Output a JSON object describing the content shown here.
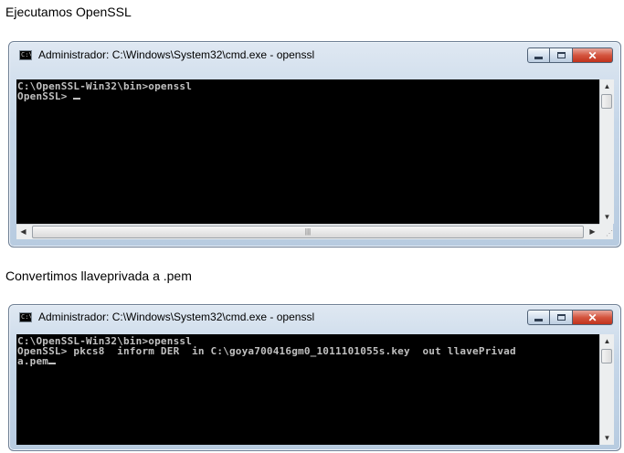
{
  "captions": {
    "first": "Ejecutamos OpenSSL",
    "second": "Convertimos llaveprivada  a .pem"
  },
  "windows": [
    {
      "title": "Administrador: C:\\Windows\\System32\\cmd.exe - openssl",
      "icon": "cmd-icon",
      "console_lines": [
        "C:\\OpenSSL-Win32\\bin>openssl",
        "OpenSSL> "
      ],
      "has_horizontal_scrollbar": true
    },
    {
      "title": "Administrador: C:\\Windows\\System32\\cmd.exe - openssl",
      "icon": "cmd-icon",
      "console_lines": [
        "C:\\OpenSSL-Win32\\bin>openssl",
        "OpenSSL> pkcs8  inform DER  in C:\\goya700416gm0_1011101055s.key  out llavePrivad",
        "a.pem"
      ],
      "has_horizontal_scrollbar": false
    }
  ],
  "window_controls": {
    "minimize": "minimize-icon",
    "maximize": "maximize-icon",
    "close": "close-icon",
    "close_glyph": "✕"
  },
  "colors": {
    "console_bg": "#000000",
    "console_text": "#c0c0c0",
    "close_button": "#c8402a"
  }
}
